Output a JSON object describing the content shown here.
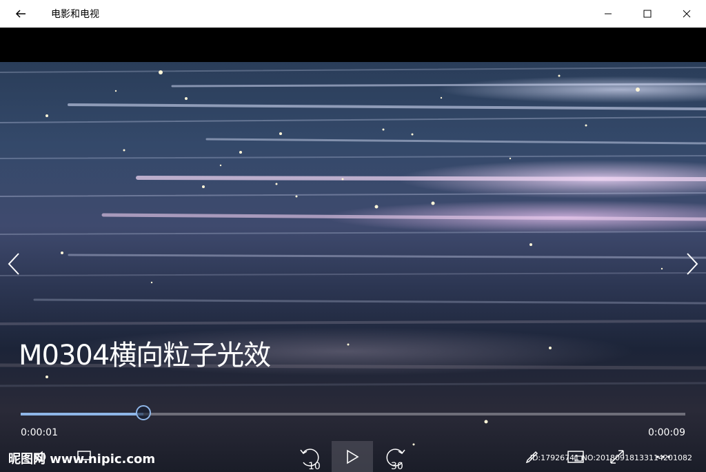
{
  "app": {
    "title": "电影和电视"
  },
  "window_controls": {
    "minimize": "minimize-icon",
    "maximize": "maximize-icon",
    "close": "close-icon"
  },
  "video": {
    "title": "M0304横向粒子光效",
    "current_time": "0:00:01",
    "duration": "0:00:09",
    "progress": 0.185
  },
  "controls": {
    "skip_back_label": "10",
    "skip_forward_label": "30",
    "play_state": "paused"
  },
  "watermark": {
    "site": "昵图网 www.nipic.com",
    "id_text": "ID:17926741 NO:20180918133114201082"
  },
  "colors": {
    "accent": "#8fb6e8",
    "titlebar": "#ffffff"
  }
}
